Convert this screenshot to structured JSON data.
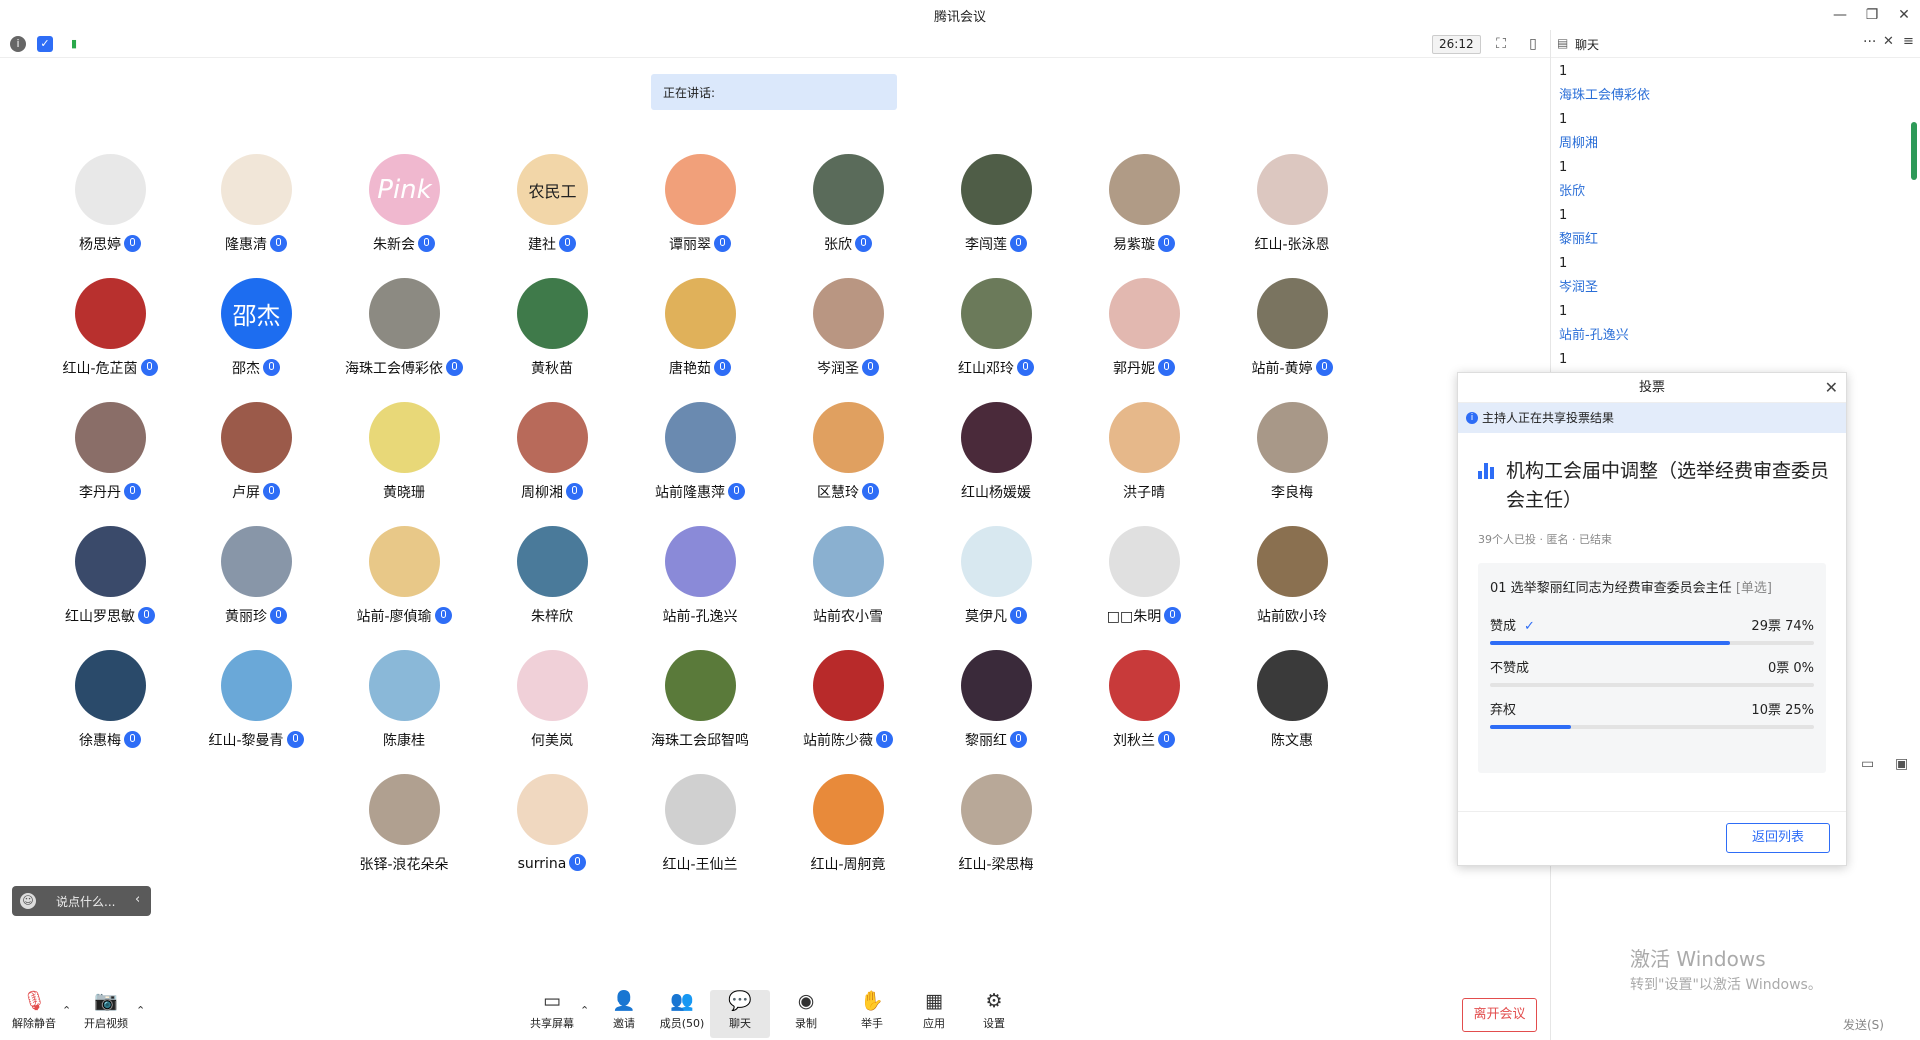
{
  "window": {
    "title": "腾讯会议",
    "min": "—",
    "max": "❐",
    "close": "✕"
  },
  "top": {
    "timer": "26:12"
  },
  "speaking": {
    "label": "正在讲话:"
  },
  "participants": [
    {
      "name": "杨思婷",
      "color": "#e8e8e8",
      "mic": true
    },
    {
      "name": "隆惠清",
      "color": "#f1e6d8",
      "mic": true
    },
    {
      "name": "朱新会",
      "color": "#f0b8cf",
      "mic": true,
      "text": "Pink"
    },
    {
      "name": "建社",
      "color": "#f2d6a8",
      "mic": true,
      "text": "农民工"
    },
    {
      "name": "谭丽翠",
      "color": "#f1a07a",
      "mic": true
    },
    {
      "name": "张欣",
      "color": "#5a6b5a",
      "mic": true
    },
    {
      "name": "李闯莲",
      "color": "#4f5d47",
      "mic": true
    },
    {
      "name": "易紫璇",
      "color": "#b09b86",
      "mic": true
    },
    {
      "name": "红山-张泳恩",
      "color": "#dcc7c0",
      "mic": false
    },
    {
      "name": "红山-危芷茵",
      "color": "#b8302e",
      "mic": true
    },
    {
      "name": "邵杰",
      "color": "#1d6df0",
      "mic": true,
      "text": "邵杰"
    },
    {
      "name": "海珠工会傅彩依",
      "color": "#8c8a82",
      "mic": true
    },
    {
      "name": "黄秋苗",
      "color": "#3f7a4a",
      "mic": false
    },
    {
      "name": "唐艳茹",
      "color": "#e0b15a",
      "mic": true
    },
    {
      "name": "岑润圣",
      "color": "#b99682",
      "mic": true
    },
    {
      "name": "红山邓玲",
      "color": "#6b7a5a",
      "mic": true
    },
    {
      "name": "郭丹妮",
      "color": "#e2b8b0",
      "mic": true
    },
    {
      "name": "站前-黄婷",
      "color": "#7a7460",
      "mic": true
    },
    {
      "name": "李丹丹",
      "color": "#8a6e68",
      "mic": true
    },
    {
      "name": "卢屏",
      "color": "#9b5a4a",
      "mic": true
    },
    {
      "name": "黄晓珊",
      "color": "#e8d878",
      "mic": false
    },
    {
      "name": "周柳湘",
      "color": "#b86a5a",
      "mic": true
    },
    {
      "name": "站前隆惠萍",
      "color": "#6a8ab0",
      "mic": true
    },
    {
      "name": "区慧玲",
      "color": "#e0a060",
      "mic": true
    },
    {
      "name": "红山杨媛媛",
      "color": "#4a2a3a",
      "mic": false
    },
    {
      "name": "洪子晴",
      "color": "#e6b88a",
      "mic": false
    },
    {
      "name": "李良梅",
      "color": "#a89888",
      "mic": false
    },
    {
      "name": "红山罗思敏",
      "color": "#3a4a6a",
      "mic": true
    },
    {
      "name": "黄丽珍",
      "color": "#8896a8",
      "mic": true
    },
    {
      "name": "站前-廖偵瑜",
      "color": "#e8c888",
      "mic": true
    },
    {
      "name": "朱梓欣",
      "color": "#4a7a9a",
      "mic": false
    },
    {
      "name": "站前-孔逸兴",
      "color": "#8a8ad8",
      "mic": false
    },
    {
      "name": "站前农小雪",
      "color": "#8ab0d0",
      "mic": false
    },
    {
      "name": "莫伊凡",
      "color": "#d8e8f0",
      "mic": true
    },
    {
      "name": "□□朱明",
      "color": "#e0e0e0",
      "mic": true
    },
    {
      "name": "站前欧小玲",
      "color": "#8a7050",
      "mic": false
    },
    {
      "name": "徐惠梅",
      "color": "#2a4a6a",
      "mic": true
    },
    {
      "name": "红山-黎曼青",
      "color": "#6aa8d8",
      "mic": true
    },
    {
      "name": "陈康桂",
      "color": "#8ab8d8",
      "mic": false
    },
    {
      "name": "何美岚",
      "color": "#f0d0d8",
      "mic": false
    },
    {
      "name": "海珠工会邱智鸣",
      "color": "#5a7a3a",
      "mic": false
    },
    {
      "name": "站前陈少薇",
      "color": "#b82a2a",
      "mic": true
    },
    {
      "name": "黎丽红",
      "color": "#3a2a3a",
      "mic": true
    },
    {
      "name": "刘秋兰",
      "color": "#c83a3a",
      "mic": true
    },
    {
      "name": "陈文惠",
      "color": "#3a3a3a",
      "mic": false
    },
    {
      "name": "张铎-浪花朵朵",
      "color": "#b0a090",
      "mic": false
    },
    {
      "name": "surrina",
      "color": "#f0d8c0",
      "mic": true
    },
    {
      "name": "红山-王仙兰",
      "color": "#d0d0d0",
      "mic": false
    },
    {
      "name": "红山-周舸竟",
      "color": "#e88a3a",
      "mic": false
    },
    {
      "name": "红山-梁思梅",
      "color": "#b8a898",
      "mic": false
    }
  ],
  "chat": {
    "title": "聊天",
    "messages": [
      {
        "type": "text",
        "text": "1"
      },
      {
        "type": "name",
        "text": "海珠工会傅彩依"
      },
      {
        "type": "text",
        "text": "1"
      },
      {
        "type": "name",
        "text": "周柳湘"
      },
      {
        "type": "text",
        "text": "1"
      },
      {
        "type": "name",
        "text": "张欣"
      },
      {
        "type": "text",
        "text": "1"
      },
      {
        "type": "name",
        "text": "黎丽红"
      },
      {
        "type": "text",
        "text": "1"
      },
      {
        "type": "name",
        "text": "岑润圣"
      },
      {
        "type": "text",
        "text": "1"
      },
      {
        "type": "name",
        "text": "站前-孔逸兴"
      },
      {
        "type": "text",
        "text": "1"
      }
    ],
    "send": "发送(S)"
  },
  "poll": {
    "window_title": "投票",
    "notice": "主持人正在共享投票结果",
    "heading": "机构工会届中调整（选举经费审查委员会主任）",
    "meta": "39个人已投 · 匿名 · 已结束",
    "question": "01  选举黎丽红同志为经费审查委员会主任",
    "question_type": "[单选]",
    "options": [
      {
        "label": "赞成",
        "count": "29票 74%",
        "fraction": 0.74,
        "checked": true
      },
      {
        "label": "不赞成",
        "count": "0票 0%",
        "fraction": 0.0,
        "checked": false
      },
      {
        "label": "弃权",
        "count": "10票 25%",
        "fraction": 0.25,
        "checked": false
      }
    ],
    "back": "返回列表"
  },
  "say": {
    "placeholder": "说点什么..."
  },
  "bottom": {
    "unmute": "解除静音",
    "video": "开启视频",
    "share": "共享屏幕",
    "invite": "邀请",
    "members": "成员(50)",
    "chat": "聊天",
    "record": "录制",
    "hand": "举手",
    "apps": "应用",
    "settings": "设置",
    "leave": "离开会议"
  },
  "watermark": {
    "line1": "激活 Windows",
    "line2": "转到\"设置\"以激活 Windows。"
  }
}
